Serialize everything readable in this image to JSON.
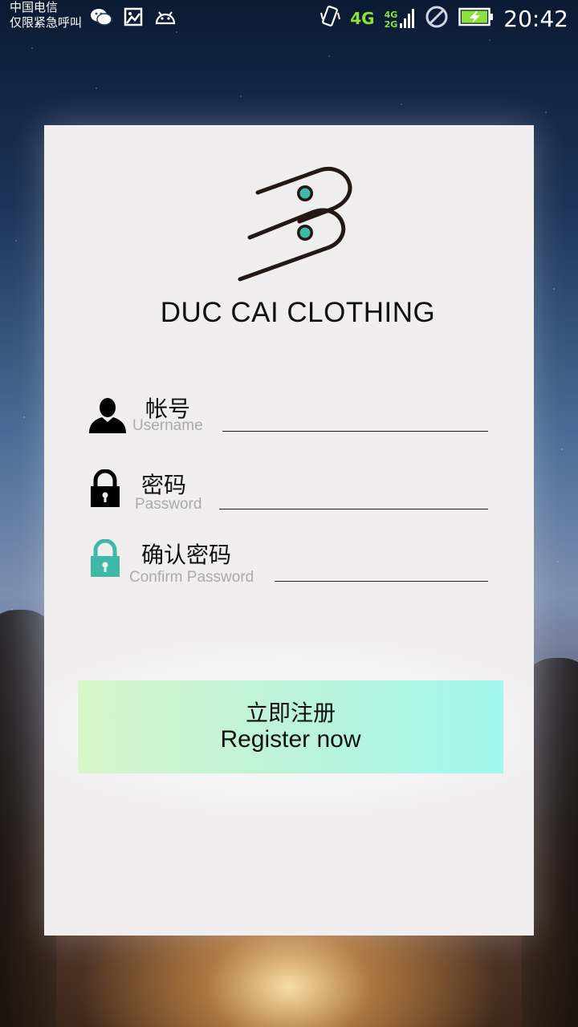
{
  "status_bar": {
    "carrier_line1": "中国电信",
    "carrier_line2": "仅限紧急呼叫",
    "network": "4G",
    "dual_network_top": "4G",
    "dual_network_bottom": "2G",
    "time": "20:42",
    "icons": [
      "wechat-icon",
      "image-icon",
      "android-icon",
      "vibrate-icon",
      "signal-icon",
      "no-sim-icon",
      "battery-charging-icon"
    ]
  },
  "brand": {
    "name": "DUC CAI CLOTHING",
    "logo_icon": "duc-cai-logo-icon",
    "logo_accent_color": "#3fb8a8"
  },
  "form": {
    "username": {
      "label_cn": "帐号",
      "label_en": "Username",
      "value": "",
      "icon": "user-icon"
    },
    "password": {
      "label_cn": "密码",
      "label_en": "Password",
      "value": "",
      "icon": "lock-icon"
    },
    "confirm_password": {
      "label_cn": "确认密码",
      "label_en": "Confirm Password",
      "value": "",
      "icon": "lock-teal-icon",
      "icon_color": "#3fb8a8"
    }
  },
  "register_button": {
    "label_cn": "立即注册",
    "label_en": "Register now",
    "gradient_start": "#d8f6c9",
    "gradient_end": "#a1f8ee"
  }
}
